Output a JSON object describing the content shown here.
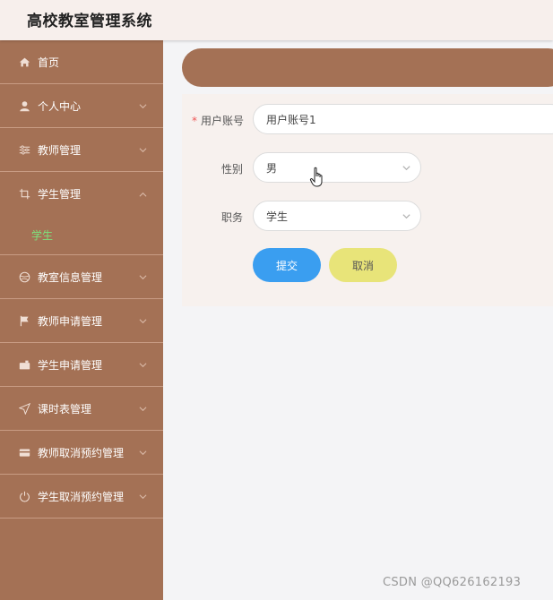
{
  "header": {
    "title": "高校教室管理系统"
  },
  "sidebar": {
    "items": [
      {
        "label": "首页",
        "icon": "home-icon"
      },
      {
        "label": "个人中心",
        "icon": "user-icon"
      },
      {
        "label": "教师管理",
        "icon": "sliders-icon"
      },
      {
        "label": "学生管理",
        "icon": "crop-icon",
        "expanded": true,
        "children": [
          {
            "label": "学生"
          }
        ]
      },
      {
        "label": "教室信息管理",
        "icon": "ball-icon"
      },
      {
        "label": "教师申请管理",
        "icon": "flag-icon"
      },
      {
        "label": "学生申请管理",
        "icon": "camera-icon"
      },
      {
        "label": "课时表管理",
        "icon": "send-icon"
      },
      {
        "label": "教师取消预约管理",
        "icon": "card-icon"
      },
      {
        "label": "学生取消预约管理",
        "icon": "power-icon"
      }
    ]
  },
  "form": {
    "account_label": "用户账号",
    "account_required": "*",
    "account_value": "用户账号1",
    "gender_label": "性别",
    "gender_value": "男",
    "role_label": "职务",
    "role_value": "学生",
    "submit_label": "提交",
    "cancel_label": "取消"
  },
  "watermark": "CSDN @QQ626162193",
  "colors": {
    "sidebar": "#a47155",
    "submit": "#3a9ef0",
    "cancel": "#e8e479",
    "active_sub": "#7de07d"
  }
}
